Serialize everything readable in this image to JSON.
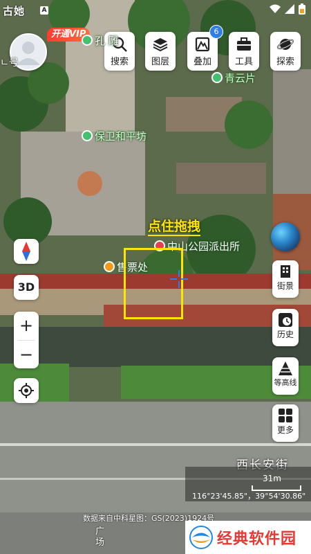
{
  "status_bar": {
    "left_text": "古她",
    "battery_icon": "battery-icon",
    "wifi_icon": "wifi-icon"
  },
  "profile": {
    "vip_label": "开通VIP",
    "corner_text": "ㄴ号"
  },
  "toolbar": {
    "search_label": "搜索",
    "layers_label": "图层",
    "overlay_label": "叠加",
    "overlay_badge": "6",
    "tools_label": "工具",
    "explore_label": "探索"
  },
  "map_labels": {
    "poi_top": "孔  雕",
    "poi_qingyun": "青云片",
    "poi_baowei": "保卫和平坊",
    "poi_police": "中山公园派出所",
    "poi_ticket": "售票处",
    "road_name": "西长安街",
    "street_vertical": "广\n场",
    "small_mark": "戶"
  },
  "drag_hint": "点住拖拽",
  "left_controls": {
    "compass_icon": "compass-icon",
    "mode_3d": "3D",
    "zoom_in": "+",
    "zoom_out": "−",
    "locate_icon": "locate-icon"
  },
  "side_panel": {
    "street_view_label": "街景",
    "history_label": "历史",
    "contour_label": "等高线",
    "more_label": "更多"
  },
  "scale": {
    "label": "31m",
    "coordinates": "116°23'45.85\"，39°54'30.86\""
  },
  "attribution": "数据来自中科星图：GS(2023)1924号",
  "watermark": "经典软件园",
  "colors": {
    "accent_yellow": "#ffe600",
    "vip_red": "#ff3b2f",
    "badge_blue": "#2f7fe8"
  }
}
